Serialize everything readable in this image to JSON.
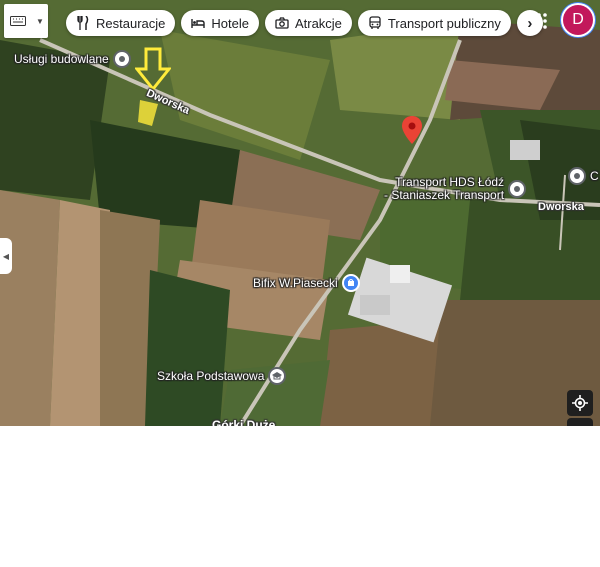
{
  "toolbar": {
    "chips": [
      {
        "label": "Restauracje",
        "icon": "fork-knife-icon"
      },
      {
        "label": "Hotele",
        "icon": "bed-icon"
      },
      {
        "label": "Atrakcje",
        "icon": "camera-icon"
      },
      {
        "label": "Transport publiczny",
        "icon": "bus-icon"
      }
    ],
    "next_symbol": "›"
  },
  "account": {
    "initial": "D",
    "color": "#c2185b"
  },
  "map": {
    "pois": [
      {
        "label": "Usługi budowlane",
        "icon": "pin-icon"
      },
      {
        "label": "Transport HDS Łódź",
        "label2": "- Staniaszek Transport",
        "icon": "pin-icon"
      },
      {
        "label": "C",
        "icon": "pin-icon"
      },
      {
        "label": "Bifix W.Piasecki",
        "icon": "shop-icon"
      },
      {
        "label": "Szkoła Podstawowa",
        "icon": "school-icon"
      }
    ],
    "roads": [
      "Dworska",
      "Dworska"
    ],
    "partial_label": "Górki Duże",
    "marker_color": "#ea4335",
    "annotation_color": "#ffeb3b"
  }
}
